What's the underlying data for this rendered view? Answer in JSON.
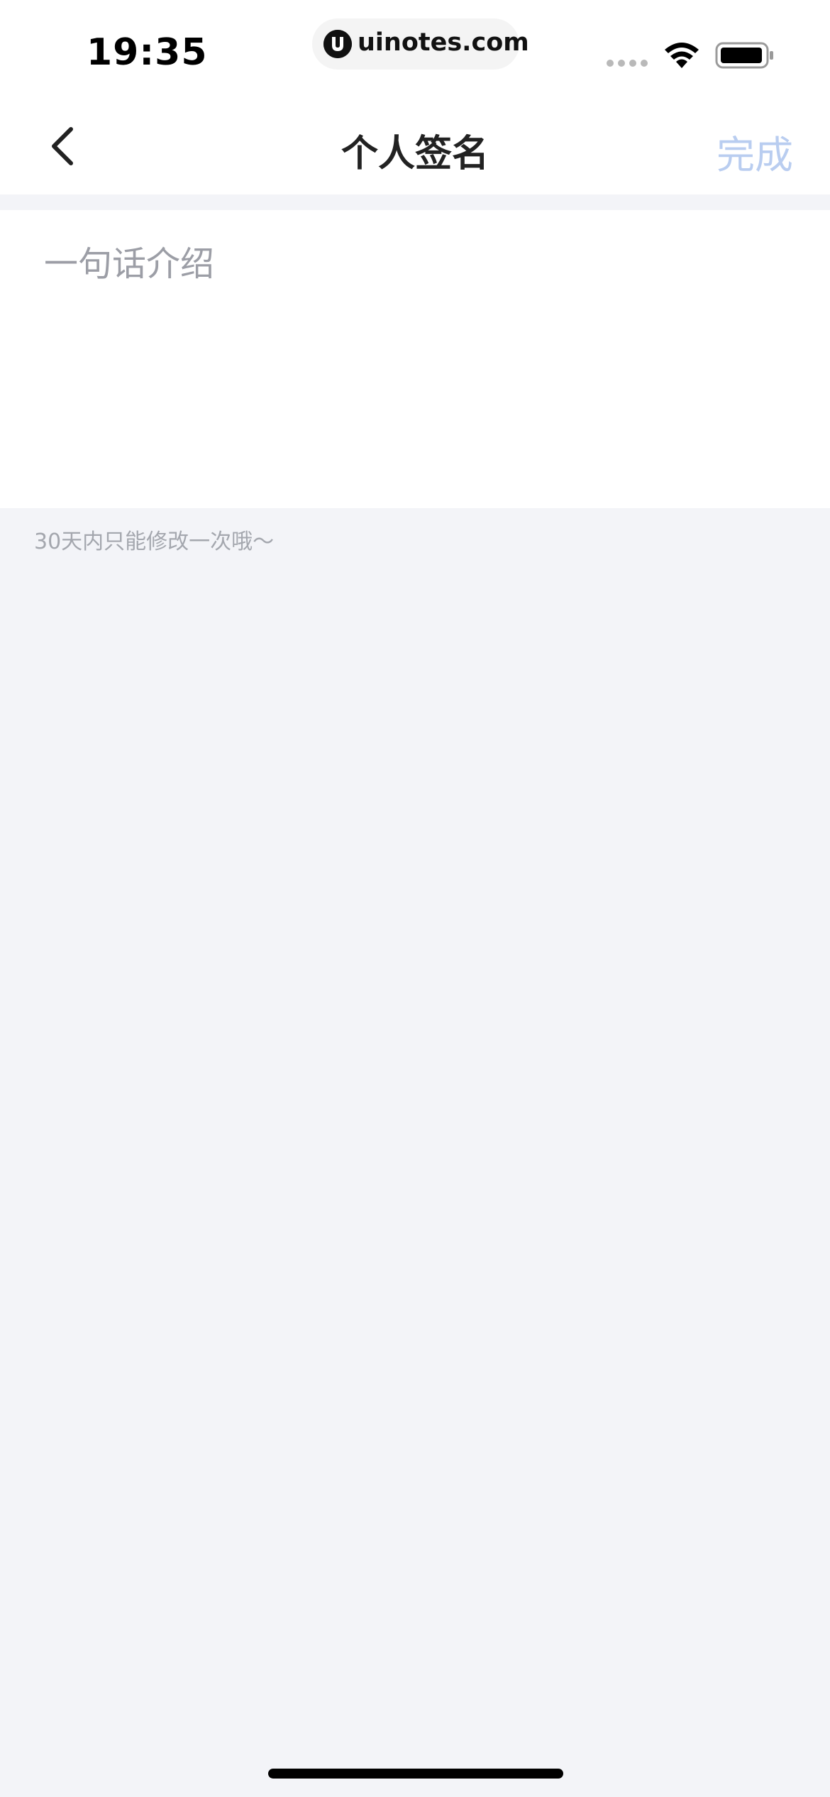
{
  "status_bar": {
    "time": "19:35",
    "url": "uinotes.com",
    "icons": [
      "signal-dots-icon",
      "wifi-icon",
      "battery-icon"
    ]
  },
  "nav": {
    "back_icon": "chevron-left-icon",
    "title": "个人签名",
    "done_label": "完成"
  },
  "signature": {
    "value": "",
    "placeholder": "一句话介绍",
    "hint": "30天内只能修改一次哦～"
  },
  "colors": {
    "page_background": "#f3f4f8",
    "done_disabled": "#b9cdf0",
    "placeholder": "#9c9ea6"
  }
}
